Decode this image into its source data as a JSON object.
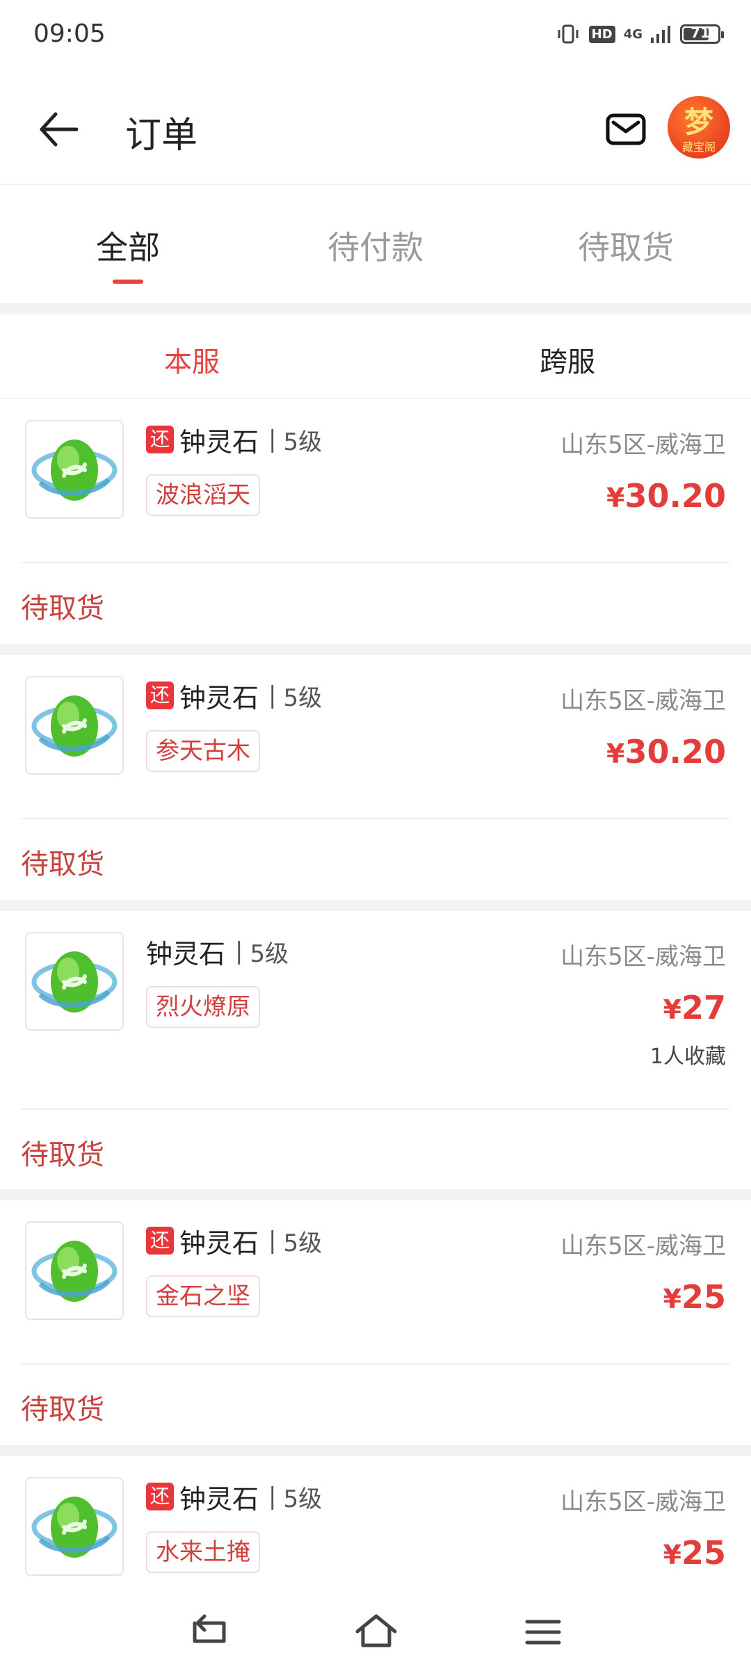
{
  "status_bar": {
    "time": "09:05",
    "hd": "HD",
    "network": "4G",
    "battery": "71"
  },
  "header": {
    "title": "订单",
    "logo_main": "梦",
    "logo_sub": "藏宝阁"
  },
  "tabs": [
    {
      "label": "全部"
    },
    {
      "label": "待付款"
    },
    {
      "label": "待取货"
    }
  ],
  "subtabs": [
    {
      "label": "本服"
    },
    {
      "label": "跨服"
    }
  ],
  "orders": [
    {
      "returnable_badge": "还",
      "name": "钟灵石",
      "divider": "|",
      "level": "5级",
      "server": "山东5区-威海卫",
      "seller": "波浪滔天",
      "currency": "¥",
      "price": "30.20",
      "status": "待取货"
    },
    {
      "returnable_badge": "还",
      "name": "钟灵石",
      "divider": "|",
      "level": "5级",
      "server": "山东5区-威海卫",
      "seller": "参天古木",
      "currency": "¥",
      "price": "30.20",
      "status": "待取货"
    },
    {
      "name": "钟灵石",
      "divider": "|",
      "level": "5级",
      "server": "山东5区-威海卫",
      "seller": "烈火燎原",
      "currency": "¥",
      "price": "27",
      "favorites": "1人收藏",
      "status": "待取货"
    },
    {
      "returnable_badge": "还",
      "name": "钟灵石",
      "divider": "|",
      "level": "5级",
      "server": "山东5区-威海卫",
      "seller": "金石之坚",
      "currency": "¥",
      "price": "25",
      "status": "待取货"
    },
    {
      "returnable_badge": "还",
      "name": "钟灵石",
      "divider": "|",
      "level": "5级",
      "server": "山东5区-威海卫",
      "seller": "水来土掩",
      "currency": "¥",
      "price": "25"
    }
  ],
  "icons": {
    "back": "back-arrow-icon",
    "mail": "mail-icon",
    "nav_back": "nav-back-icon",
    "nav_home": "nav-home-icon",
    "nav_menu": "nav-menu-icon"
  },
  "colors": {
    "accent": "#e64340",
    "price": "#e23d3a",
    "status": "#c8413d"
  }
}
